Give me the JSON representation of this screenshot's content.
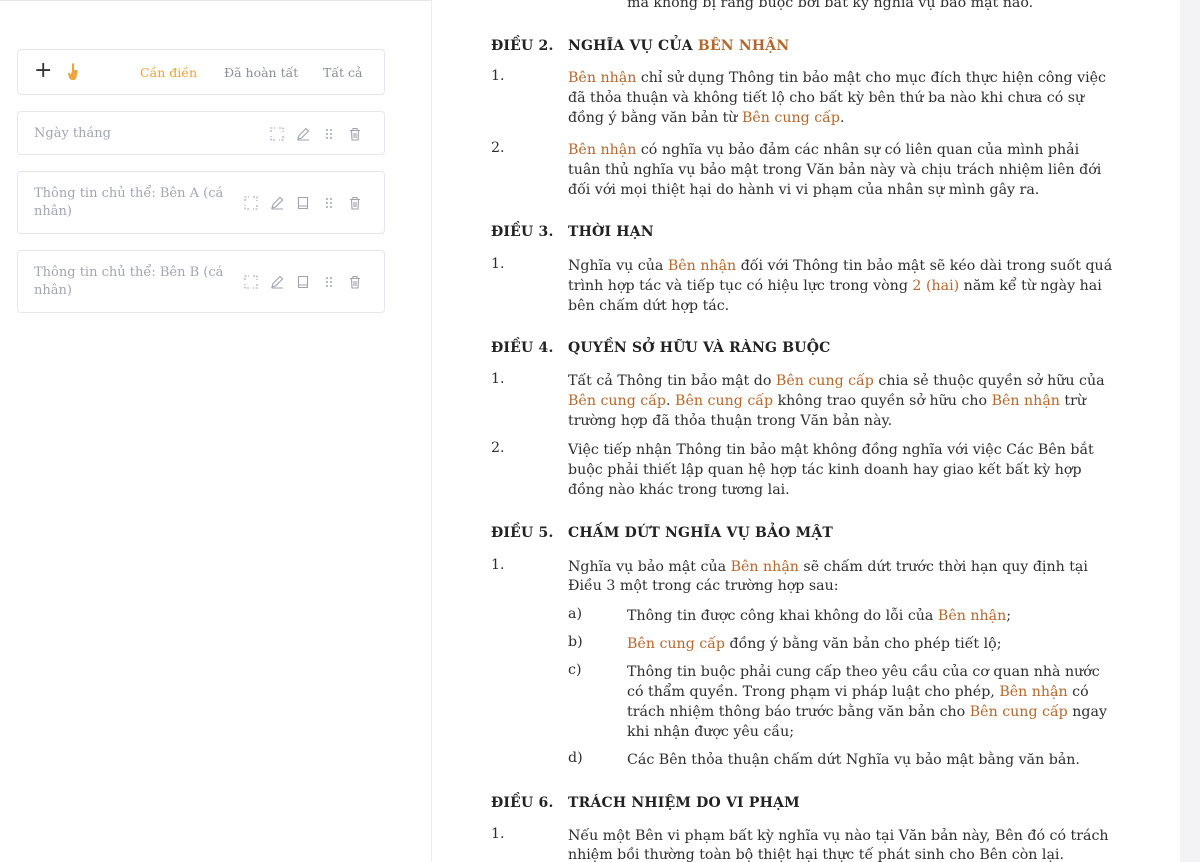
{
  "toolbar": {
    "add_label": "+",
    "tabs": [
      "Cần điền",
      "Đã hoàn tất",
      "Tất cả"
    ]
  },
  "fields": [
    {
      "label": "Ngày tháng"
    },
    {
      "label_line1": "Thông tin chủ thể: Bên A (cá",
      "label_line2": "nhân)"
    },
    {
      "label_line1": "Thông tin chủ thể: Bên B (cá",
      "label_line2": "nhân)"
    }
  ],
  "colors": {
    "accent": "#e8a23a",
    "highlight": "#b5682e"
  },
  "icons": [
    "plus-icon",
    "hand-pointer-icon",
    "expand-icon",
    "edit-icon",
    "book-icon",
    "drag-handle-icon",
    "trash-icon"
  ],
  "document": {
    "top_fragment": "mà không bị ràng buộc bởi bất kỳ nghĩa vụ bảo mật nào.",
    "dieu2": {
      "num": "ĐIỀU 2.",
      "title_a": "NGHĨA VỤ CỦA ",
      "title_b": "BÊN NHẬN",
      "p1_num": "1.",
      "p1_l1_a": "Bên nhận",
      "p1_l1_b": " chỉ sử dụng Thông tin bảo mật cho mục đích thực hiện công việc",
      "p1_l2": "đã thỏa thuận và không tiết lộ cho bất kỳ bên thứ ba nào khi chưa có sự",
      "p1_l3_a": "đồng ý bằng văn bản từ ",
      "p1_l3_b": "Bên cung cấp",
      "p1_l3_c": ".",
      "p2_num": "2.",
      "p2_l1_a": "Bên nhận",
      "p2_l1_b": " có nghĩa vụ bảo đảm các nhân sự có liên quan của mình phải",
      "p2_l2": "tuân thủ nghĩa vụ bảo mật trong Văn bản này và chịu trách nhiệm liên đới",
      "p2_l3": "đối với mọi thiệt hại do hành vi vi phạm của nhân sự mình gây ra."
    },
    "dieu3": {
      "num": "ĐIỀU 3.",
      "title": "THỜI HẠN",
      "p1_num": "1.",
      "p1_l1_a": "Nghĩa vụ của ",
      "p1_l1_b": "Bên nhận",
      "p1_l1_c": " đối với Thông tin bảo mật sẽ kéo dài trong suốt quá",
      "p1_l2_a": "trình hợp tác và tiếp tục có hiệu lực trong vòng ",
      "p1_l2_b": "2 (hai)",
      "p1_l2_c": " năm kể từ ngày hai",
      "p1_l3": "bên chấm dứt hợp tác."
    },
    "dieu4": {
      "num": "ĐIỀU 4.",
      "title": "QUYỀN SỞ HỮU VÀ RÀNG BUỘC",
      "p1_num": "1.",
      "p1_l1_a": "Tất cả Thông tin bảo mật do ",
      "p1_l1_b": "Bên cung cấp",
      "p1_l1_c": " chia sẻ thuộc quyền sở hữu của",
      "p1_l2_a": "Bên cung cấp",
      "p1_l2_b": ". ",
      "p1_l2_c": "Bên cung cấp",
      "p1_l2_d": " không trao quyền sở hữu cho ",
      "p1_l2_e": "Bên nhận",
      "p1_l2_f": " trừ",
      "p1_l3": "trường hợp đã thỏa thuận trong Văn bản này.",
      "p2_num": "2.",
      "p2_l1": "Việc tiếp nhận Thông tin bảo mật không đồng nghĩa với việc Các Bên bắt",
      "p2_l2": "buộc phải thiết lập quan hệ hợp tác kinh doanh hay giao kết bất kỳ hợp",
      "p2_l3": "đồng nào khác trong tương lai."
    },
    "dieu5": {
      "num": "ĐIỀU 5.",
      "title": "CHẤM DỨT NGHĨA VỤ BẢO MẬT",
      "p1_num": "1.",
      "p1_l1_a": "Nghĩa vụ bảo mật của ",
      "p1_l1_b": "Bên nhận",
      "p1_l1_c": " sẽ chấm dứt trước thời hạn quy định tại",
      "p1_l2": "Điều 3 một trong các trường hợp sau:",
      "a_lbl": "a)",
      "a_a": "Thông tin được công khai không do lỗi của ",
      "a_b": "Bên nhận",
      "a_c": ";",
      "b_lbl": "b)",
      "b_a": "Bên cung cấp",
      "b_b": " đồng ý bằng văn bản cho phép tiết lộ;",
      "c_lbl": "c)",
      "c_l1": "Thông tin buộc phải cung cấp theo yêu cầu của cơ quan nhà nước",
      "c_l2_a": "có thẩm quyền. Trong phạm vi pháp luật cho phép, ",
      "c_l2_b": "Bên nhận",
      "c_l2_c": " có",
      "c_l3_a": "trách nhiệm thông báo trước bằng văn bản cho ",
      "c_l3_b": "Bên cung cấp",
      "c_l3_c": " ngay",
      "c_l4": "khi nhận được yêu cầu;",
      "d_lbl": "d)",
      "d_text": "Các Bên thỏa thuận chấm dứt Nghĩa vụ bảo mật bằng văn bản."
    },
    "dieu6": {
      "num": "ĐIỀU 6.",
      "title": "TRÁCH NHIỆM DO VI PHẠM",
      "p1_num": "1.",
      "p1_l1": "Nếu một Bên vi phạm bất kỳ nghĩa vụ nào tại Văn bản này, Bên đó có trách",
      "p1_l2": "nhiệm bồi thường toàn bộ thiệt hại thực tế phát sinh cho Bên còn lại."
    }
  }
}
